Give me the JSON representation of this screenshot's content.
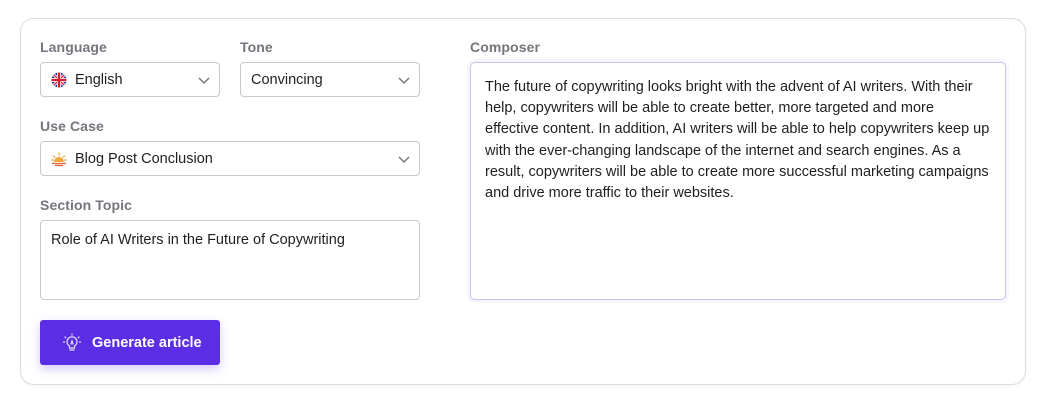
{
  "form": {
    "language": {
      "label": "Language",
      "value": "English",
      "icon": "uk-flag-icon"
    },
    "tone": {
      "label": "Tone",
      "value": "Convincing"
    },
    "use_case": {
      "label": "Use Case",
      "value": "Blog Post Conclusion",
      "icon": "sunrise-icon"
    },
    "section_topic": {
      "label": "Section Topic",
      "value": "Role of AI Writers in the Future of Copywriting"
    },
    "generate_button": {
      "label": "Generate article",
      "icon": "lightbulb-icon",
      "color": "#5b2ee6"
    }
  },
  "composer": {
    "label": "Composer",
    "text": "The future of copywriting looks bright with the advent of AI writers. With their help, copywriters will be able to create better, more targeted and more effective content. In addition, AI writers will be able to help copywriters keep up with the ever-changing landscape of the internet and search engines. As a result, copywriters will be able to create more successful marketing campaigns and drive more traffic to their websites."
  }
}
